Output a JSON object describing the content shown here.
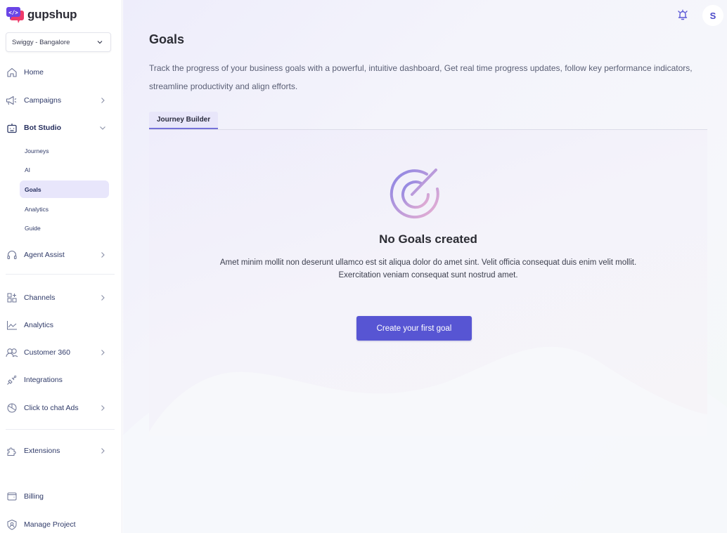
{
  "brand": {
    "name": "gupshup",
    "accent": "#5755d3"
  },
  "sidebar": {
    "project_selector": {
      "value": "Swiggy - Bangalore",
      "icon": "chevron-down-icon"
    },
    "items": [
      {
        "label": "Home",
        "icon": "home-icon",
        "has_chevron": false
      },
      {
        "label": "Campaigns",
        "icon": "megaphone-icon",
        "has_chevron": true
      },
      {
        "label": "Bot Studio",
        "icon": "bot-icon",
        "has_chevron": true,
        "expanded": true,
        "children": [
          {
            "label": "Journeys"
          },
          {
            "label": "AI"
          },
          {
            "label": "Goals",
            "selected": true
          },
          {
            "label": "Analytics"
          },
          {
            "label": "Guide"
          }
        ]
      },
      {
        "label": "Agent Assist",
        "icon": "headset-icon",
        "has_chevron": true
      },
      {
        "label": "Channels",
        "icon": "channels-grid-icon",
        "has_chevron": true
      },
      {
        "label": "Analytics",
        "icon": "line-chart-icon",
        "has_chevron": false
      },
      {
        "label": "Customer 360",
        "icon": "users-icon",
        "has_chevron": true
      },
      {
        "label": "Integrations",
        "icon": "plug-icon",
        "has_chevron": false
      },
      {
        "label": "Click to chat Ads",
        "icon": "pie-chart-icon",
        "has_chevron": true
      },
      {
        "label": "Extensions",
        "icon": "puzzle-icon",
        "has_chevron": true
      },
      {
        "label": "Billing",
        "icon": "wallet-icon",
        "has_chevron": false
      },
      {
        "label": "Manage Project",
        "icon": "shield-user-icon",
        "has_chevron": false
      }
    ]
  },
  "topbar": {
    "notification_icon": "bell-icon",
    "avatar_initial": "S"
  },
  "main": {
    "title": "Goals",
    "description": "Track the progress of your business goals with a powerful, intuitive dashboard, Get real time progress updates, follow key performance indicators, streamline productivity and align efforts.",
    "tabs": [
      {
        "label": "Journey Builder",
        "active": true
      }
    ],
    "empty_state": {
      "icon": "target-icon",
      "title": "No Goals created",
      "description": "Amet minim mollit non deserunt ullamco est sit aliqua dolor do amet sint. Velit officia consequat duis enim velit mollit. Exercitation veniam consequat sunt nostrud amet.",
      "cta_label": "Create your first goal"
    }
  }
}
